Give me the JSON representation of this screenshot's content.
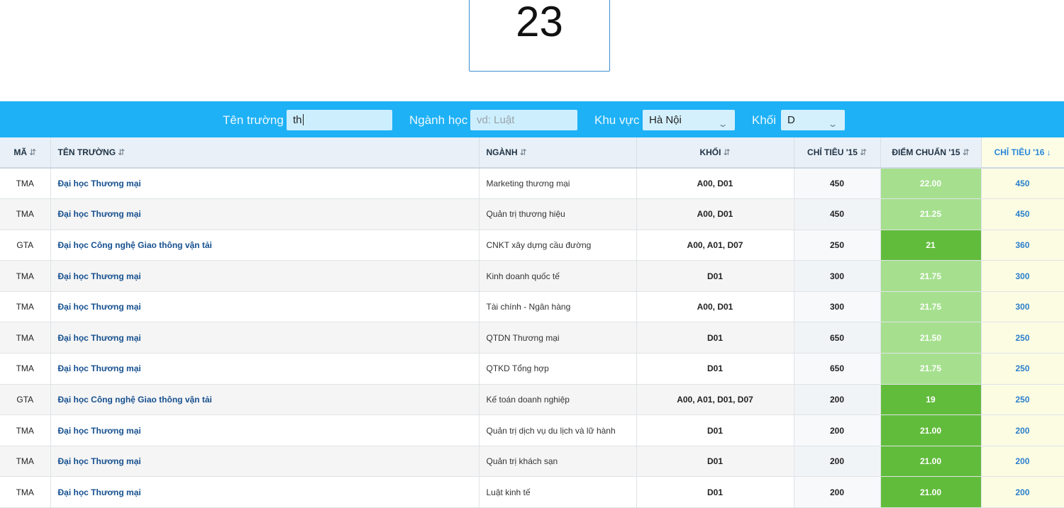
{
  "count": "23",
  "filters": {
    "school_label": "Tên trường",
    "school_value": "th",
    "major_label": "Ngành học",
    "major_placeholder": "vd: Luật",
    "region_label": "Khu vực",
    "region_value": "Hà Nội",
    "block_label": "Khối",
    "block_value": "D"
  },
  "icons": {
    "sort": "⇵",
    "sort_down": "↓",
    "chevron": "⌄"
  },
  "colors": {
    "filter_bar": "#1eb1f6",
    "score_light": "#a6e08f",
    "score_dark": "#62bc3c"
  },
  "table": {
    "headers": [
      "MÃ",
      "TÊN TRƯỜNG",
      "NGÀNH",
      "KHỐI",
      "CHỈ TIÊU '15",
      "ĐIỂM CHUẨN '15",
      "CHỈ TIÊU '16"
    ],
    "rows": [
      {
        "code": "TMA",
        "school": "Đại học Thương mại",
        "major": "Marketing thương mại",
        "block": "A00, D01",
        "quota15": "450",
        "score15": "22.00",
        "level": "light",
        "quota16": "450"
      },
      {
        "code": "TMA",
        "school": "Đại học Thương mại",
        "major": "Quản trị thương hiệu",
        "block": "A00, D01",
        "quota15": "450",
        "score15": "21.25",
        "level": "light",
        "quota16": "450"
      },
      {
        "code": "GTA",
        "school": "Đại học Công nghệ Giao thông vận tải",
        "major": "CNKT xây dựng cầu đường",
        "block": "A00, A01, D07",
        "quota15": "250",
        "score15": "21",
        "level": "dark",
        "quota16": "360"
      },
      {
        "code": "TMA",
        "school": "Đại học Thương mại",
        "major": "Kinh doanh quốc tế",
        "block": "D01",
        "quota15": "300",
        "score15": "21.75",
        "level": "light",
        "quota16": "300"
      },
      {
        "code": "TMA",
        "school": "Đại học Thương mại",
        "major": "Tài chính - Ngân hàng",
        "block": "A00, D01",
        "quota15": "300",
        "score15": "21.75",
        "level": "light",
        "quota16": "300"
      },
      {
        "code": "TMA",
        "school": "Đại học Thương mại",
        "major": "QTDN Thương mại",
        "block": "D01",
        "quota15": "650",
        "score15": "21.50",
        "level": "light",
        "quota16": "250"
      },
      {
        "code": "TMA",
        "school": "Đại học Thương mại",
        "major": "QTKD Tổng hợp",
        "block": "D01",
        "quota15": "650",
        "score15": "21.75",
        "level": "light",
        "quota16": "250"
      },
      {
        "code": "GTA",
        "school": "Đại học Công nghệ Giao thông vận tải",
        "major": "Kế toán doanh nghiệp",
        "block": "A00, A01, D01, D07",
        "quota15": "200",
        "score15": "19",
        "level": "dark",
        "quota16": "250"
      },
      {
        "code": "TMA",
        "school": "Đại học Thương mại",
        "major": "Quản trị dịch vụ du lịch và lữ hành",
        "block": "D01",
        "quota15": "200",
        "score15": "21.00",
        "level": "dark",
        "quota16": "200"
      },
      {
        "code": "TMA",
        "school": "Đại học Thương mại",
        "major": "Quản trị khách sạn",
        "block": "D01",
        "quota15": "200",
        "score15": "21.00",
        "level": "dark",
        "quota16": "200"
      },
      {
        "code": "TMA",
        "school": "Đại học Thương mại",
        "major": "Luật kinh tế",
        "block": "D01",
        "quota15": "200",
        "score15": "21.00",
        "level": "dark",
        "quota16": "200"
      }
    ]
  }
}
